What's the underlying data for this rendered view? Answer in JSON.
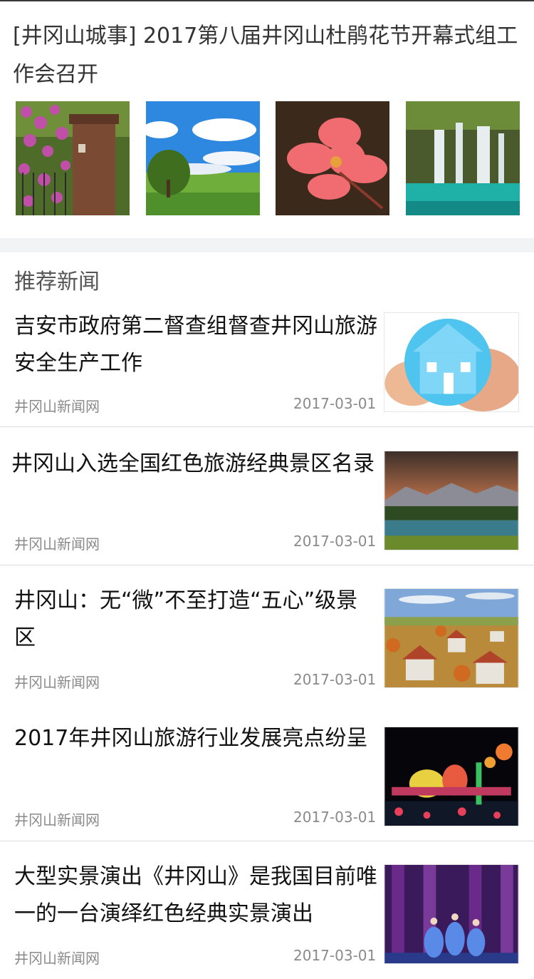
{
  "feature": {
    "title": "[井冈山城事] 2017第八届井冈山杜鹃花节开幕式组工作会召开",
    "images": [
      "flowers-gate-photo",
      "sky-tree-photo",
      "azalea-photo",
      "waterfall-photo"
    ]
  },
  "section_title": "推荐新闻",
  "news": [
    {
      "title": "吉安市政府第二督查组督查井冈山旅游安全生产工作",
      "source": "井冈山新闻网",
      "date": "2017-03-01",
      "image": "house-in-hands-photo"
    },
    {
      "title": "井冈山入选全国红色旅游经典景区名录",
      "source": "井冈山新闻网",
      "date": "2017-03-01",
      "image": "lake-sunset-photo"
    },
    {
      "title": "井冈山：无“微”不至打造“五心”级景区",
      "source": "井冈山新闻网",
      "date": "2017-03-01",
      "image": "village-photo"
    },
    {
      "title": "2017年井冈山旅游行业发展亮点纷呈",
      "source": "井冈山新闻网",
      "date": "2017-03-01",
      "image": "lantern-festival-photo"
    },
    {
      "title": "大型实景演出《井冈山》是我国目前唯一的一台演绎红色经典实景演出",
      "source": "井冈山新闻网",
      "date": "2017-03-01",
      "image": "dance-performance-photo"
    }
  ]
}
